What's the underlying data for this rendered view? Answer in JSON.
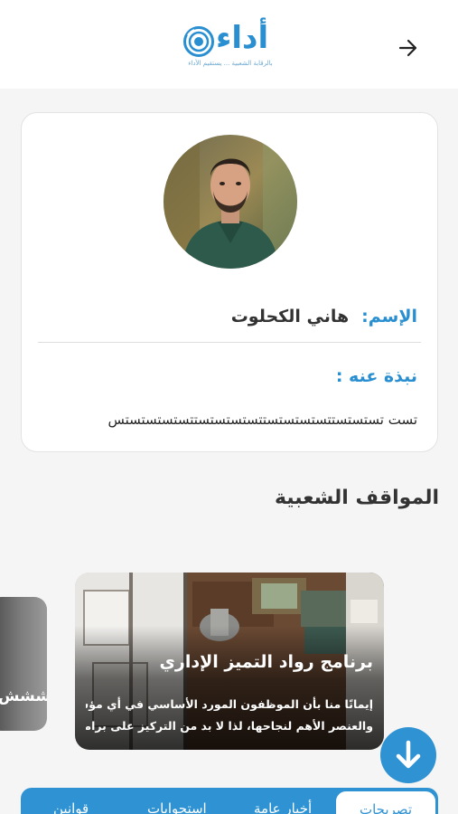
{
  "header": {
    "logo_text": "أداء",
    "logo_tagline": "بالرقابة الشعبية ... يستقيم الأداء",
    "back_icon": "arrow-right-icon"
  },
  "profile": {
    "name_label": "الإسم:",
    "name_value": "هاني الكحلوت",
    "about_label": "نبذة عنه :",
    "about_text": "تست تستستستتستستستستتستستستستتستستستستس"
  },
  "section": {
    "title": "المواقف الشعبية"
  },
  "cards": [
    {
      "title": "ششششش"
    },
    {
      "title": "برنامج رواد التميز الإداري",
      "desc_line1": "إيمانًا منا بأن الموظفون المورد الأساسي في أي مؤسسة",
      "desc_line2": "والعنصر الأهم لنجاحها، لذا لا بد من التركيز على برامج..."
    }
  ],
  "fab": {
    "icon": "arrow-down-icon"
  },
  "tabs": [
    {
      "label": "تصريحات",
      "active": true
    },
    {
      "label": "أخبار عامة",
      "active": false
    },
    {
      "label": "استجوابات",
      "active": false
    },
    {
      "label": "قوانين",
      "active": false
    }
  ],
  "colors": {
    "accent": "#2f93d3",
    "label_blue": "#2a8fd0",
    "background": "#f5f5f5"
  }
}
